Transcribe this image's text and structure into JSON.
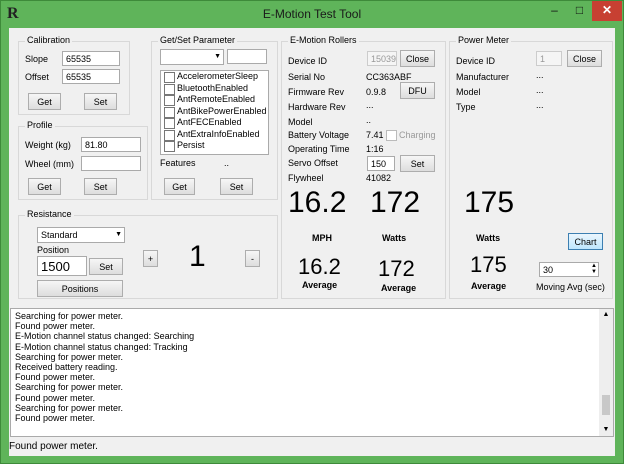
{
  "window": {
    "title": "E-Motion Test Tool",
    "icon": "R",
    "min": "–",
    "max": "□",
    "close": "✕"
  },
  "calibration": {
    "title": "Calibration",
    "slope_label": "Slope",
    "slope": "65535",
    "offset_label": "Offset",
    "offset": "65535",
    "get": "Get",
    "set": "Set"
  },
  "profile": {
    "title": "Profile",
    "weight_label": "Weight (kg)",
    "weight": "81.80",
    "wheel_label": "Wheel (mm)",
    "wheel": "",
    "get": "Get",
    "set": "Set"
  },
  "getset": {
    "title": "Get/Set Parameter",
    "param_value": "",
    "features": [
      "AccelerometerSleep",
      "BluetoothEnabled",
      "AntRemoteEnabled",
      "AntBikePowerEnabled",
      "AntFECEnabled",
      "AntExtraInfoEnabled",
      "Persist"
    ],
    "features_label": "Features",
    "features_value": "..",
    "get": "Get",
    "set": "Set"
  },
  "resistance": {
    "title": "Resistance",
    "mode": "Standard",
    "position_label": "Position",
    "position": "1500",
    "set": "Set",
    "positions": "Positions",
    "plus": "+",
    "minus": "-",
    "level": "1"
  },
  "rollers": {
    "title": "E-Motion Rollers",
    "device_id_label": "Device ID",
    "device_id": "15039",
    "close": "Close",
    "serial_label": "Serial No",
    "serial": "CC363ABF",
    "firmware_label": "Firmware Rev",
    "firmware": "0.9.8",
    "dfu": "DFU",
    "hardware_label": "Hardware Rev",
    "hardware": "...",
    "model_label": "Model",
    "model": "..",
    "battery_label": "Battery Voltage",
    "battery": "7.41",
    "charging": "Charging",
    "optime_label": "Operating Time",
    "optime": "1:16",
    "servo_label": "Servo Offset",
    "servo": "150",
    "set": "Set",
    "flywheel_label": "Flywheel",
    "flywheel": "41082",
    "speed": "16.2",
    "speed_unit": "MPH",
    "watts": "172",
    "watts_unit": "Watts",
    "avg_speed": "16.2",
    "avg_watts": "172",
    "avg_label": "Average"
  },
  "power": {
    "title": "Power Meter",
    "device_id_label": "Device ID",
    "device_id": "1",
    "close": "Close",
    "mfr_label": "Manufacturer",
    "mfr": "...",
    "model_label": "Model",
    "model": "...",
    "type_label": "Type",
    "type": "...",
    "watts": "175",
    "watts_unit": "Watts",
    "chart": "Chart",
    "avg_watts": "175",
    "avg_label": "Average",
    "moving_avg": "30",
    "moving_avg_label": "Moving Avg (sec)"
  },
  "log": [
    "Searching for power meter.",
    "Found power meter.",
    "E-Motion channel status changed: Searching",
    "E-Motion channel status changed: Tracking",
    "Searching for power meter.",
    "Received battery reading.",
    "Found power meter.",
    "Searching for power meter.",
    "Found power meter.",
    "Searching for power meter.",
    "Found power meter."
  ],
  "status": "Found power meter."
}
